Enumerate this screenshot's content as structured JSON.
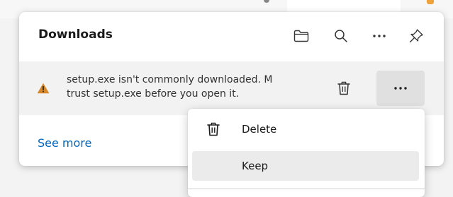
{
  "downloads_panel": {
    "title": "Downloads",
    "header_icons": [
      "folder-icon",
      "search-icon",
      "more-horizontal-icon",
      "pin-icon"
    ]
  },
  "download_item": {
    "warning_icon": "warning-triangle-icon",
    "message_line1": "setup.exe isn't commonly downloaded. M",
    "message_line2": "trust setup.exe before you open it.",
    "delete_icon": "trash-icon",
    "more_icon": "more-horizontal-icon"
  },
  "footer": {
    "see_more_label": "See more"
  },
  "context_menu": {
    "items": [
      {
        "label": "Delete",
        "icon": "trash-icon"
      },
      {
        "label": "Keep",
        "icon": ""
      }
    ],
    "highlighted": "Keep"
  },
  "colors": {
    "link": "#0067c0",
    "warning": "#d8872a",
    "item_bg": "#f2f2f2",
    "hover": "#ebebeb"
  }
}
